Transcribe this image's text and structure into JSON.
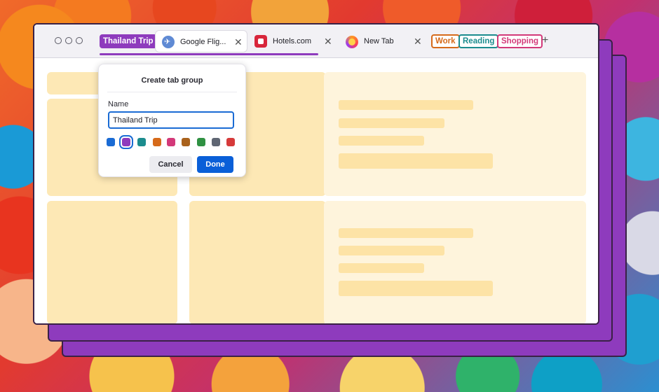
{
  "tab_groups": [
    {
      "label": "Thailand Trip",
      "color": "#8e3bbd"
    },
    {
      "label": "Work",
      "color": "#d66a1a"
    },
    {
      "label": "Reading",
      "color": "#1c8c8e"
    },
    {
      "label": "Shopping",
      "color": "#d33979"
    }
  ],
  "tabs": [
    {
      "label": "Google Flig...",
      "favicon": "airplane-icon",
      "active": true,
      "close": "✕"
    },
    {
      "label": "Hotels.com",
      "favicon": "hotels-icon",
      "active": false,
      "close": "✕"
    },
    {
      "label": "New Tab",
      "favicon": "firefox-icon",
      "active": false,
      "close": "✕"
    }
  ],
  "new_tab_symbol": "+",
  "dialog": {
    "title": "Create tab group",
    "name_label": "Name",
    "name_value": "Thailand Trip",
    "colors": [
      "#1a6bd4",
      "#8e3bbd",
      "#1c8c8e",
      "#d66a1a",
      "#d33979",
      "#a9621c",
      "#2f9142",
      "#5f6673",
      "#d63a3a"
    ],
    "selected_color_index": 1,
    "cancel_label": "Cancel",
    "done_label": "Done"
  }
}
